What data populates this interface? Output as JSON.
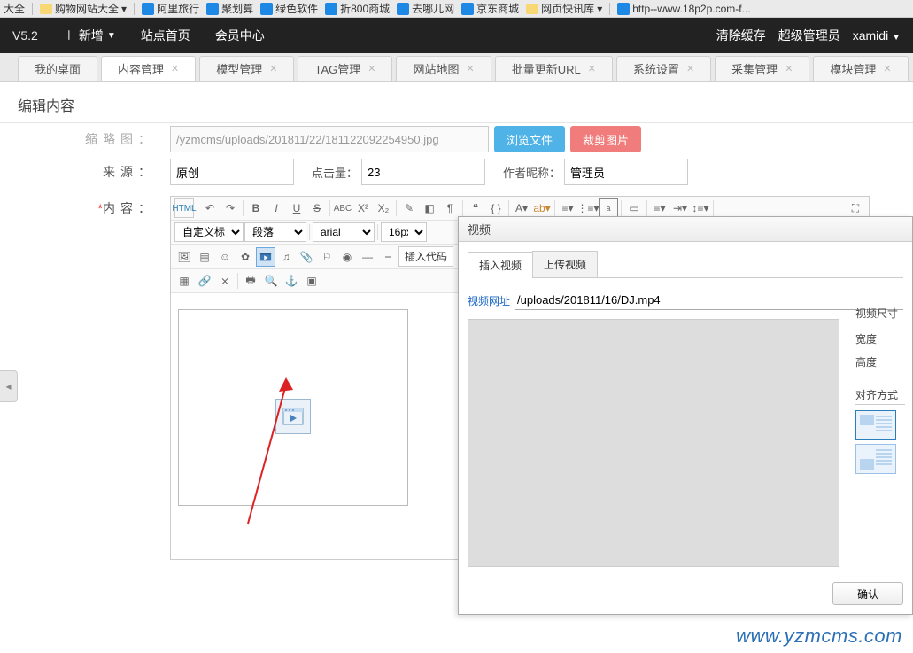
{
  "bookmarks": {
    "b0": "大全",
    "b1": "购物网站大全",
    "b2": "阿里旅行",
    "b3": "聚划算",
    "b4": "绿色软件",
    "b5": "折800商城",
    "b6": "去哪儿网",
    "b7": "京东商城",
    "b8": "网页快讯库",
    "b9": "http--www.18p2p.com-f..."
  },
  "topbar": {
    "version": "V5.2",
    "add": "新增",
    "home": "站点首页",
    "member": "会员中心",
    "clear": "清除缓存",
    "role": "超级管理员",
    "user": "xamidi"
  },
  "tabs": {
    "t0": "我的桌面",
    "t1": "内容管理",
    "t2": "模型管理",
    "t3": "TAG管理",
    "t4": "网站地图",
    "t5": "批量更新URL",
    "t6": "系统设置",
    "t7": "采集管理",
    "t8": "模块管理"
  },
  "page": {
    "title": "编辑内容"
  },
  "form": {
    "thumb_label": "缩略图：",
    "thumb_value": "/yzmcms/uploads/201811/22/181122092254950.jpg",
    "browse": "浏览文件",
    "crop": "裁剪图片",
    "source_label": "来源：",
    "source_value": "原创",
    "hits_label": "点击量：",
    "hits_value": "23",
    "author_label": "作者昵称：",
    "author_value": "管理员",
    "content_label": "内容：",
    "req": "*"
  },
  "editor": {
    "html": "HTML",
    "headingSel": "自定义标题",
    "paraSel": "段落",
    "fontSel": "arial",
    "sizeSel": "16px",
    "insertCode": "插入代码"
  },
  "dialog": {
    "title": "视频",
    "tab1": "插入视频",
    "tab2": "上传视频",
    "urlLabel": "视频网址",
    "urlValue": "/uploads/201811/16/DJ.mp4",
    "sizeHd": "视频尺寸",
    "w": "宽度",
    "h": "高度",
    "alignHd": "对齐方式",
    "ok": "确认"
  },
  "watermark": "www.yzmcms.com"
}
